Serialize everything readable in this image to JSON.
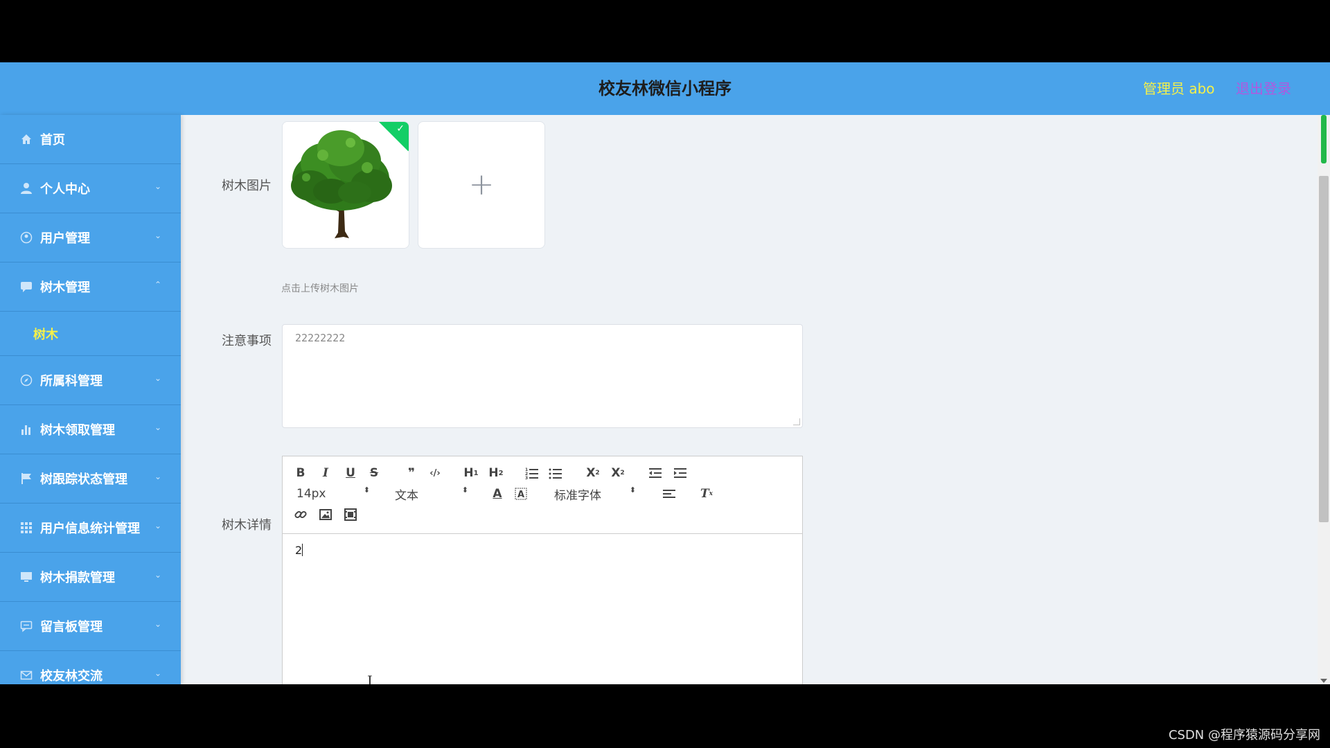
{
  "header": {
    "title": "校友林微信小程序",
    "admin_label": "管理员 abo",
    "logout_label": "退出登录"
  },
  "sidebar": {
    "items": [
      {
        "label": "首页",
        "icon": "home-icon"
      },
      {
        "label": "个人中心",
        "icon": "user-icon"
      },
      {
        "label": "用户管理",
        "icon": "users-icon"
      },
      {
        "label": "树木管理",
        "icon": "chat-icon"
      },
      {
        "label": "树木",
        "icon": ""
      },
      {
        "label": "所属科管理",
        "icon": "compass-icon"
      },
      {
        "label": "树木领取管理",
        "icon": "bar-chart-icon"
      },
      {
        "label": "树跟踪状态管理",
        "icon": "flag-icon"
      },
      {
        "label": "用户信息统计管理",
        "icon": "grid-icon"
      },
      {
        "label": "树木捐款管理",
        "icon": "monitor-icon"
      },
      {
        "label": "留言板管理",
        "icon": "message-icon"
      },
      {
        "label": "校友林交流",
        "icon": "mail-icon"
      }
    ]
  },
  "form": {
    "image_label": "树木图片",
    "upload_hint": "点击上传树木图片",
    "notes_label": "注意事项",
    "notes_value": "22222222",
    "detail_label": "树木详情",
    "editor": {
      "font_size": "14px",
      "header_type": "文本",
      "font_family": "标准字体",
      "content": "2"
    }
  },
  "watermark": "CSDN @程序猿源码分享网",
  "colors": {
    "header_bg": "#4aa3ea",
    "sidebar_bg": "#4aa3ea",
    "active_text": "#f4f04a",
    "logout_text": "#b158e0",
    "success": "#13ce66"
  }
}
